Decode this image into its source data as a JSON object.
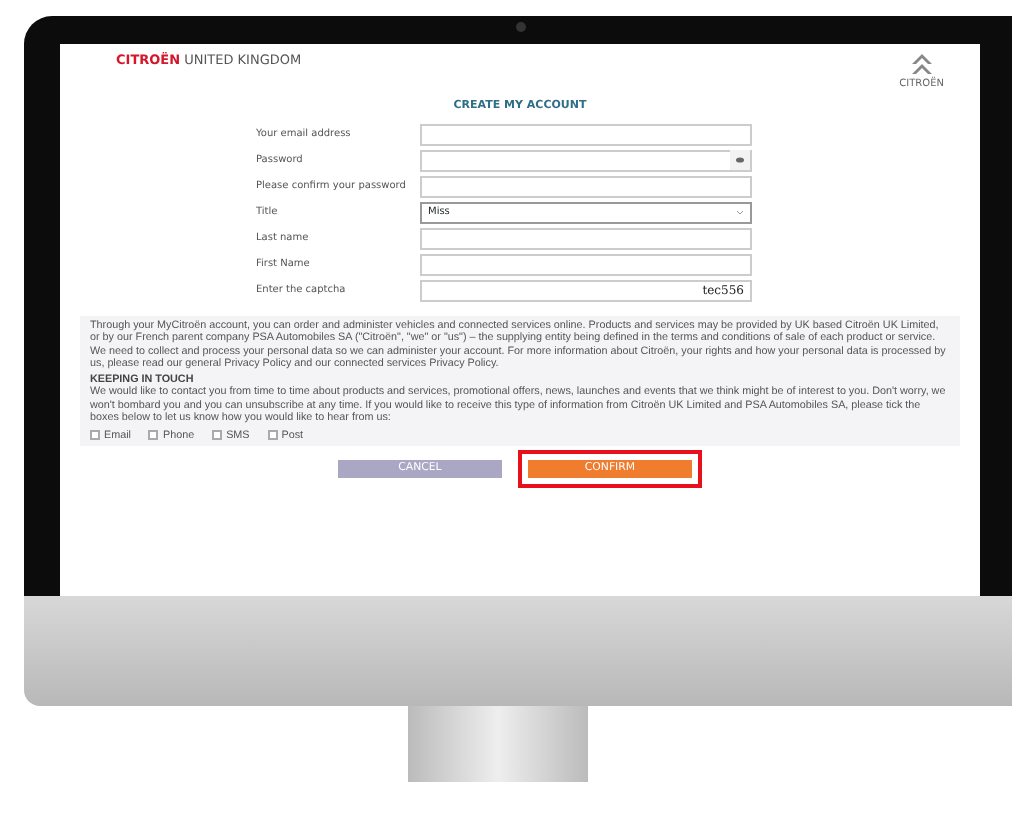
{
  "header": {
    "brand_red": "CITROËN",
    "brand_rest": "UNITED KINGDOM",
    "logo_text": "CITROËN"
  },
  "title": "CREATE MY ACCOUNT",
  "fields": [
    {
      "label": "Your email address",
      "kind": "text"
    },
    {
      "label": "Password",
      "kind": "password"
    },
    {
      "label": "Please confirm your password",
      "kind": "text"
    },
    {
      "label": "Title",
      "kind": "select",
      "value": "Miss"
    },
    {
      "label": "Last name",
      "kind": "text"
    },
    {
      "label": "First Name",
      "kind": "text"
    },
    {
      "label": "Enter the captcha",
      "kind": "captcha",
      "captcha": "tec556"
    }
  ],
  "notice": {
    "paragraph": "Through your MyCitroën account, you can order and administer vehicles and connected services online. Products and services may be provided by UK based Citroën UK Limited, or by our French parent company PSA Automobiles SA (\"Citroën\", \"we\" or \"us\") – the supplying entity being defined in the terms and conditions of sale of each product or service. We need to collect and process your personal data so we can administer your account. For more information about Citroën, your rights and how your personal data is processed by us, please read our general Privacy Policy and our connected services Privacy Policy.",
    "heading": "KEEPING IN TOUCH",
    "paragraph2": "We would like to contact you from time to time about products and services, promotional offers, news, launches and events that we think might be of interest to you. Don't worry, we won't bombard you and you can unsubscribe at any time. If you would like to receive this type of information from Citroën UK Limited and PSA Automobiles SA, please tick the boxes below to let us know how you would like to hear from us:",
    "options": [
      {
        "label": "Email",
        "checked": false
      },
      {
        "label": "Phone",
        "checked": false
      },
      {
        "label": "SMS",
        "checked": false
      },
      {
        "label": "Post",
        "checked": false
      }
    ]
  },
  "buttons": [
    {
      "label": "CANCEL",
      "kind": "cancel",
      "highlighted": false
    },
    {
      "label": "CONFIRM",
      "kind": "confirm",
      "highlighted": true
    }
  ]
}
